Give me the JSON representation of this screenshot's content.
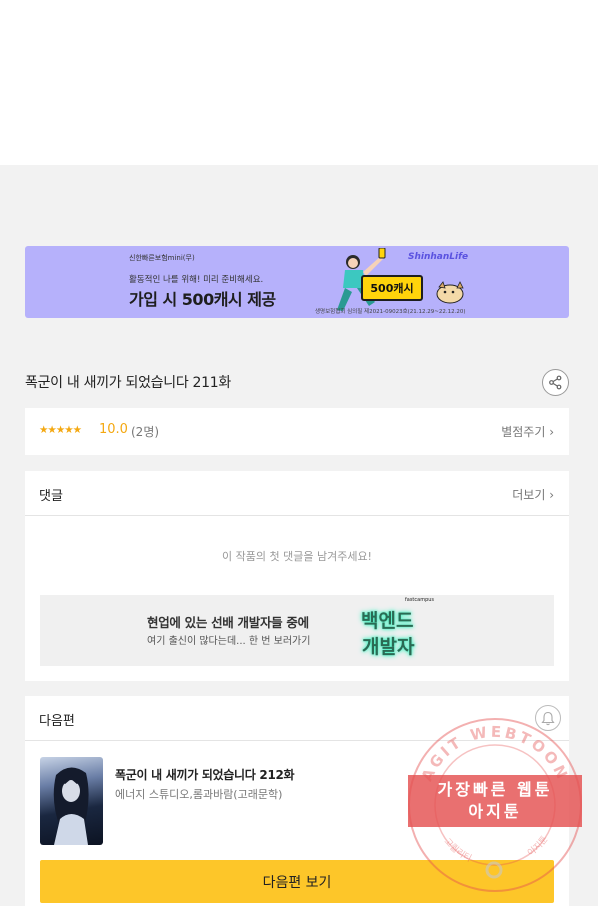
{
  "banner": {
    "brand": "신한빠른보험mini(무)",
    "subtitle": "활동적인 나를 위해! 미리 준비해세요.",
    "headline": "가입 시 500캐시 제공",
    "logo": "ShinhanLife",
    "cash_badge": "500캐시",
    "fine_print": "생명보험협회 심의필 제2021-09023호(21.12.29~22.12.20)",
    "bg_color": "#b6b1fb"
  },
  "episode": {
    "title": "폭군이 내 새끼가 되었습니다 211화",
    "share_icon": "share-icon"
  },
  "rating": {
    "stars": "★★★★★",
    "score": "10.0",
    "count": "(2명)",
    "rate_link": "별점주기 ›",
    "star_color": "#f4a811"
  },
  "comments": {
    "label": "댓글",
    "more": "더보기 ›",
    "empty_text": "이 작품의 첫 댓글을 남겨주세요!"
  },
  "ad2": {
    "line1": "현업에 있는 선배 개발자들 중에",
    "line2": "여기 출신이 많다는데... 한 번 보러가기",
    "big1": "백엔드",
    "big2": "개발자",
    "brand": "fastcampus"
  },
  "next_episode": {
    "label": "다음편",
    "bell_icon": "bell-icon",
    "title": "폭군이 내 새끼가 되었습니다 212화",
    "author": "에너지 스튜디오,롬과바람(고래문학)",
    "button": "다음편 보기",
    "button_color": "#fdc629"
  },
  "watermark": {
    "line1": "가장빠른 웹툰",
    "line2": "아지툰",
    "ring_top": "AGIT WEBTOON",
    "ring_bottom_left": "고퀄리티",
    "ring_bottom_right": "아지툰"
  }
}
